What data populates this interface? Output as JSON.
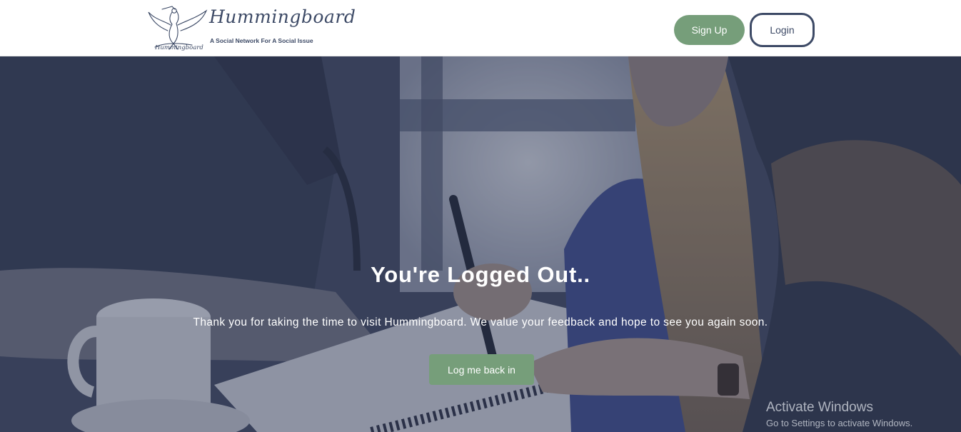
{
  "header": {
    "logo_name": "Hummingboard",
    "logo_tagline": "A Social Network For A Social Issue",
    "logo_icon": "hummingbird-logo-icon",
    "signup_label": "Sign Up",
    "login_label": "Login"
  },
  "hero": {
    "title": "You're Logged Out..",
    "message": "Thank you for taking the time to visit Hummingboard. We value your feedback and hope to see you again soon.",
    "button_label": "Log me back in"
  },
  "watermark": {
    "title": "Activate Windows",
    "subtitle": "Go to Settings to activate Windows."
  },
  "colors": {
    "accent_green": "#769e7a",
    "navy": "#3d4a66",
    "overlay": "#2c344e"
  }
}
